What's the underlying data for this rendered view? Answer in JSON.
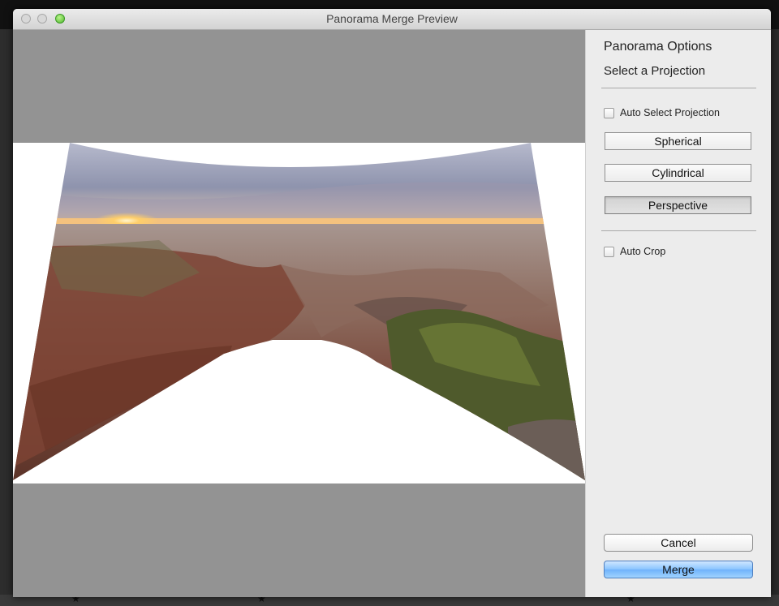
{
  "dialog": {
    "title": "Panorama Merge Preview"
  },
  "options": {
    "heading": "Panorama Options",
    "subheading": "Select a Projection",
    "auto_select_projection": {
      "label": "Auto Select Projection",
      "checked": false
    },
    "projections": [
      {
        "label": "Spherical",
        "selected": false
      },
      {
        "label": "Cylindrical",
        "selected": false
      },
      {
        "label": "Perspective",
        "selected": true
      }
    ],
    "auto_crop": {
      "label": "Auto Crop",
      "checked": false
    }
  },
  "actions": {
    "cancel_label": "Cancel",
    "merge_label": "Merge"
  },
  "colors": {
    "merge_button": "#88c4ff",
    "preview_background": "#939393",
    "panel_background": "#ececec"
  }
}
